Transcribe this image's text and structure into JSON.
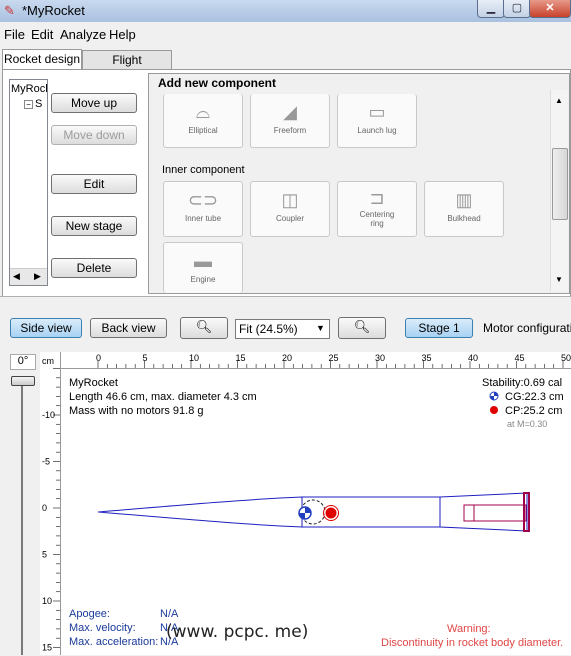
{
  "window": {
    "title": "*MyRocket"
  },
  "menu": [
    "File",
    "Edit",
    "Analyze",
    "Help"
  ],
  "tabs": [
    "Rocket design",
    "Flight simulations"
  ],
  "tree": {
    "root": "MyRocket",
    "child": "S"
  },
  "design_buttons": {
    "move_up": "Move up",
    "move_down": "Move down",
    "edit": "Edit",
    "new_stage": "New stage",
    "delete": "Delete"
  },
  "add_component": {
    "title": "Add new component",
    "body_row": [
      "Elliptical",
      "Freeform",
      "Launch lug"
    ],
    "inner_title": "Inner component",
    "inner_row": [
      "Inner tube",
      "Coupler",
      "Centering ring",
      "Bulkhead"
    ],
    "extra_row": [
      "Engine"
    ]
  },
  "view_toolbar": {
    "side_view": "Side view",
    "back_view": "Back view",
    "zoom": "Fit (24.5%)",
    "stage": "Stage 1",
    "motor_config": "Motor configuration"
  },
  "rotation": "0°",
  "ruler": {
    "unit": "cm",
    "h_ticks": [
      "0",
      "5",
      "10",
      "15",
      "20",
      "25",
      "30",
      "35",
      "40",
      "45",
      "50"
    ],
    "v_ticks": [
      "-10",
      "-5",
      "0",
      "5",
      "10",
      "15"
    ]
  },
  "rocket_info": {
    "name": "MyRocket",
    "dimensions": "Length 46.6 cm, max. diameter 4.3 cm",
    "mass": "Mass with no motors 91.8 g",
    "stability": "Stability:0.69 cal",
    "cg": "CG:22.3 cm",
    "cp": "CP:25.2 cm",
    "mach": "at M=0.30"
  },
  "flight_info": {
    "apogee_label": "Apogee:",
    "apogee_value": "N/A",
    "velocity_label": "Max. velocity:",
    "velocity_value": "N/A",
    "accel_label": "Max. acceleration:",
    "accel_value": "N/A"
  },
  "warning": {
    "title": "Warning:",
    "text": "Discontinuity in rocket body diameter."
  },
  "watermark": "(www. pcpc. me)",
  "colors": {
    "body": "#1f1fbf",
    "motor": "#a0004a",
    "cg": "#1f3fbf",
    "cp": "#e00000"
  }
}
